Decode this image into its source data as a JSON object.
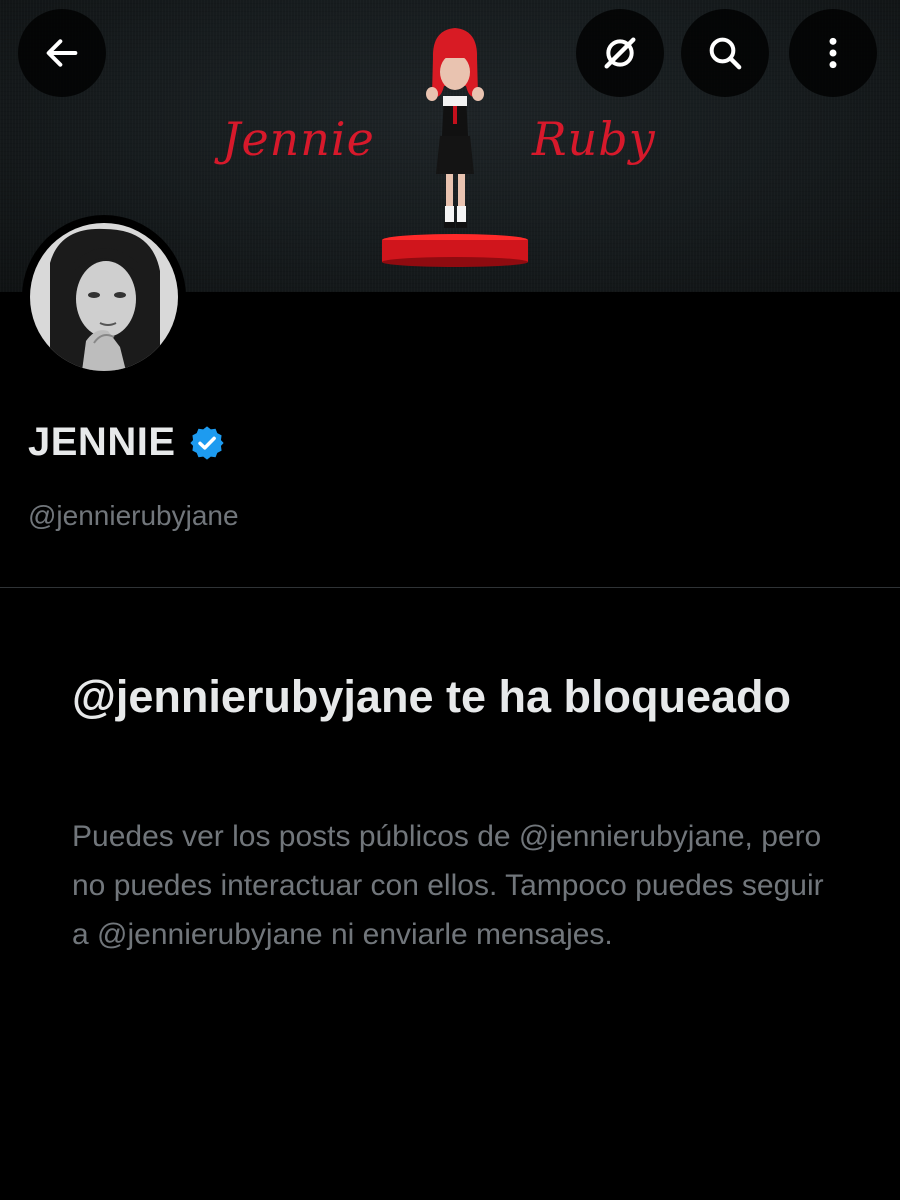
{
  "header": {
    "back_icon": "arrow-left-icon",
    "actions": [
      "grok-icon",
      "search-icon",
      "more-vertical-icon"
    ]
  },
  "banner": {
    "script_left": "Jennie",
    "script_right": "Ruby",
    "accent_color": "#d7192b"
  },
  "profile": {
    "name": "JENNIE",
    "verified": true,
    "handle": "@jennierubyjane"
  },
  "blocked_notice": {
    "title": "@jennierubyjane te ha bloqueado",
    "description": "Puedes ver los posts públicos de @jennierubyjane, pero no puedes interactuar con ellos. Tampoco puedes seguir a @jennierubyjane ni enviarle mensajes."
  },
  "colors": {
    "background": "#000000",
    "text_primary": "#e7e9ea",
    "text_secondary": "#71767b",
    "verified_blue": "#1d9bf0",
    "divider": "#2f3336"
  }
}
